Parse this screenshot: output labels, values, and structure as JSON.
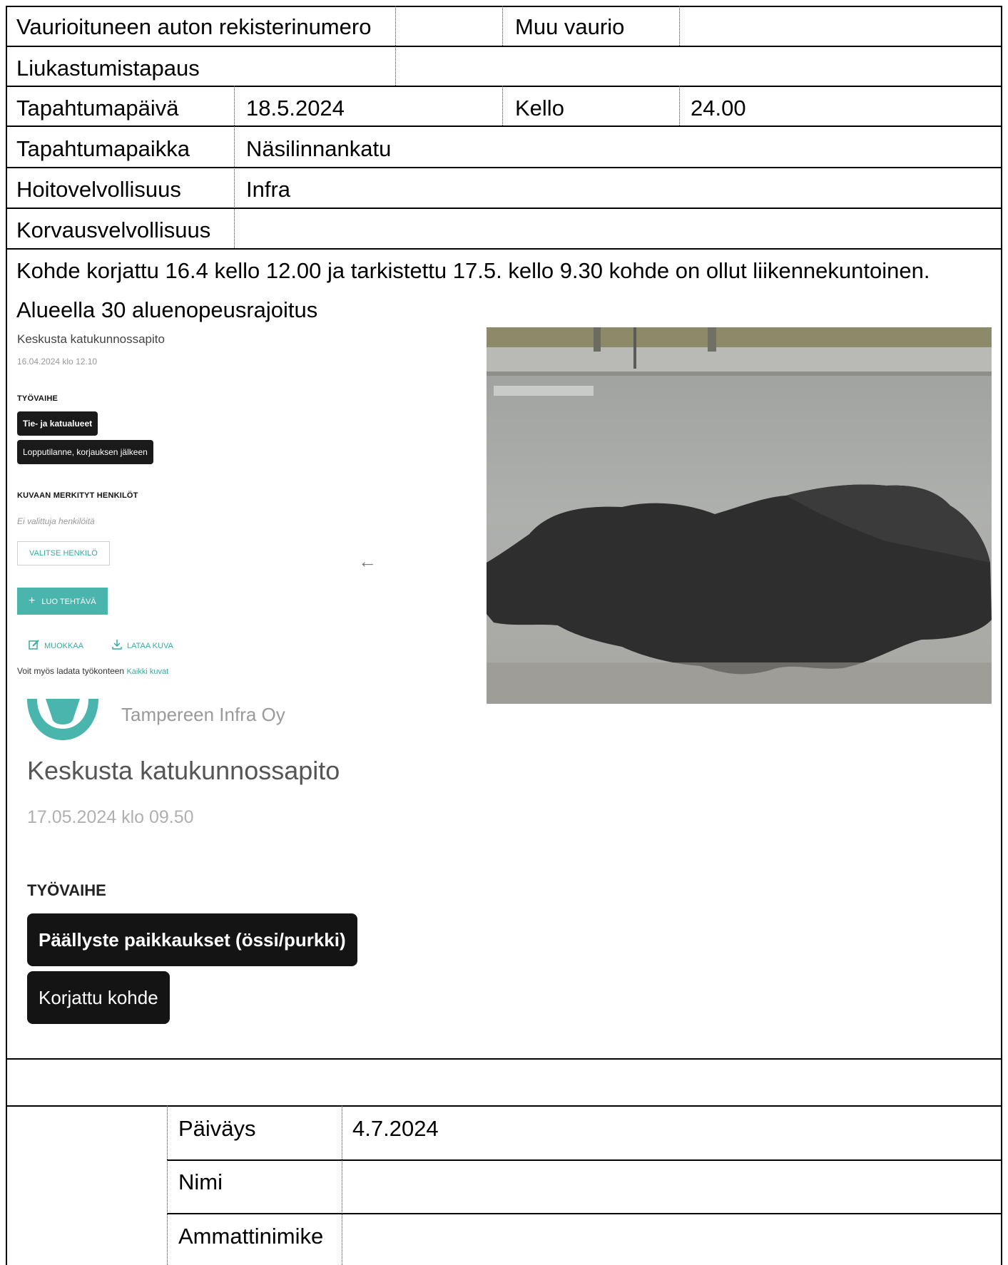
{
  "form": {
    "row1": {
      "label": "Vaurioituneen auton rekisterinumero",
      "value": "",
      "label2": "Muu vaurio",
      "value2": ""
    },
    "row2": {
      "label": "Liukastumistapaus",
      "value": ""
    },
    "row3": {
      "label": "Tapahtumapäivä",
      "value": "18.5.2024",
      "label2": "Kello",
      "value2": "24.00"
    },
    "row4": {
      "label": "Tapahtumapaikka",
      "value": "Näsilinnankatu"
    },
    "row5": {
      "label": "Hoitovelvollisuus",
      "value": "Infra"
    },
    "row6": {
      "label": "Korvausvelvollisuus",
      "value": ""
    },
    "description": {
      "line1": "Kohde korjattu 16.4 kello 12.00 ja tarkistettu 17.5. kello 9.30 kohde on ollut liikennekuntoinen.",
      "line2": "Alueella 30 aluenopeusrajoitus"
    },
    "signature": {
      "date_label": "Päiväys",
      "date_value": "4.7.2024",
      "name_label": "Nimi",
      "name_value": "",
      "title_label": "Ammattinimike",
      "title_value": ""
    }
  },
  "screenshot_small": {
    "title": "Keskusta katukunnossapito",
    "date": "16.04.2024 klo 12.10",
    "phase_heading": "TYÖVAIHE",
    "chip1": "Tie- ja katualueet",
    "chip2": "Lopputilanne, korjauksen jälkeen",
    "persons_heading": "KUVAAN MERKITYT HENKILÖT",
    "no_persons": "Ei valittuja henkilöitä",
    "select_person": "VALITSE HENKILÖ",
    "create_task": "LUO TEHTÄVÄ",
    "edit": "MUOKKAA",
    "download": "LATAA KUVA",
    "hint_text": "Voit myös ladata työkonteen",
    "hint_link": "Kaikki kuvat",
    "arrow": "←",
    "accent_color": "#4ab5ad"
  },
  "screenshot_large": {
    "company": "Tampereen Infra Oy",
    "title": "Keskusta katukunnossapito",
    "date": "17.05.2024 klo 09.50",
    "phase_heading": "TYÖVAIHE",
    "chip1": "Päällyste paikkaukset (össi/purkki)",
    "chip2": "Korjattu kohde"
  }
}
